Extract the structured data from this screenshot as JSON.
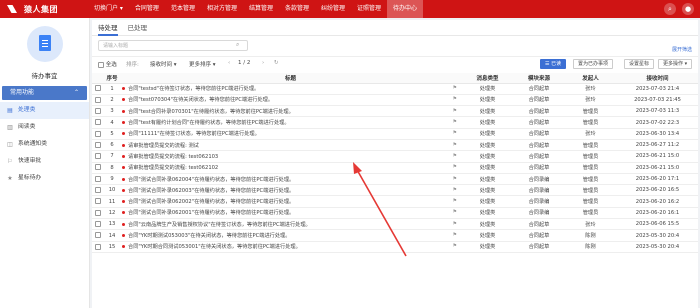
{
  "brand": {
    "name": "猿人集团"
  },
  "nav": [
    {
      "label": "切换门户 ▾"
    },
    {
      "label": "合同管理"
    },
    {
      "label": "范本管理"
    },
    {
      "label": "相对方管理"
    },
    {
      "label": "结算管理"
    },
    {
      "label": "条款管理"
    },
    {
      "label": "纠纷管理"
    },
    {
      "label": "证照管理"
    },
    {
      "label": "待办中心",
      "active": true
    }
  ],
  "sidebar": {
    "title": "待办事宜",
    "section": "常用功能",
    "items": [
      {
        "label": "处理类",
        "icon": "list-icon",
        "active": true
      },
      {
        "label": "阅读类",
        "icon": "book-icon"
      },
      {
        "label": "系统通知类",
        "icon": "bell-icon"
      },
      {
        "label": "快速审批",
        "icon": "check-icon"
      },
      {
        "label": "星标待办",
        "icon": "star-icon"
      }
    ]
  },
  "tabs": [
    {
      "label": "待处理",
      "active": true
    },
    {
      "label": "已处理"
    }
  ],
  "search": {
    "placeholder": "请输入标题"
  },
  "expand_link": "展开筛选",
  "toolbar": {
    "select_all": "全选",
    "sort_label": "排序:",
    "sort_field": "接收时间 ▾",
    "more_sort": "更多排序 ▾",
    "pager": "1 / 2",
    "prev": "‹",
    "next": "›",
    "btn_read": "已读",
    "btn_mark": "置为已办事项",
    "btn_settings": "设置星标",
    "btn_more": "更多操作 ▾"
  },
  "table": {
    "headers": [
      "序号",
      "标题",
      "消息类型",
      "模块来源",
      "发起人",
      "接收时间"
    ],
    "rows": [
      {
        "no": "1",
        "dot": true,
        "title": "合同\"testsd\"在待签订状态，等待您前往PC端进行处理。",
        "type": "处理类",
        "module": "合同起草",
        "sender": "张玲",
        "time": "2023-07-03 21:4"
      },
      {
        "no": "2",
        "dot": true,
        "title": "合同\"test070304\"在待关闭状态，等待您前往PC端进行处理。",
        "type": "处理类",
        "module": "合同起草",
        "sender": "张玲",
        "time": "2023-07-03 21:45"
      },
      {
        "no": "3",
        "dot": true,
        "title": "合同\"test合同补录070301\"在待履约状态，等待您前往PC端进行处理。",
        "type": "处理类",
        "module": "合同起草",
        "sender": "管理员",
        "time": "2023-07-03 11:3"
      },
      {
        "no": "4",
        "dot": true,
        "title": "合同\"test有履约计划合同\"在待履约状态，等待您前往PC端进行处理。",
        "type": "处理类",
        "module": "合同起草",
        "sender": "管理员",
        "time": "2023-07-02 22:3"
      },
      {
        "no": "5",
        "dot": true,
        "title": "合同\"11111\"在待签订状态，等待您前往PC端进行处理。",
        "type": "处理类",
        "module": "合同起草",
        "sender": "张玲",
        "time": "2023-06-30 13:4"
      },
      {
        "no": "6",
        "dot": true,
        "title": "请审批管理员提交的流程: 测试",
        "type": "处理类",
        "module": "合同起草",
        "sender": "管理员",
        "time": "2023-06-27 11:2"
      },
      {
        "no": "7",
        "dot": true,
        "title": "请审批管理员提交的流程: test062103",
        "type": "处理类",
        "module": "合同起草",
        "sender": "管理员",
        "time": "2023-06-21 15:0"
      },
      {
        "no": "8",
        "dot": true,
        "title": "请审批管理员提交的流程: test062102",
        "type": "处理类",
        "module": "合同起草",
        "sender": "管理员",
        "time": "2023-06-21 15:0"
      },
      {
        "no": "9",
        "dot": true,
        "title": "合同\"测试合同补录062004\"在待履约状态，等待您前往PC端进行处理。",
        "type": "处理类",
        "module": "合同录编",
        "sender": "管理员",
        "time": "2023-06-20 17:1"
      },
      {
        "no": "10",
        "dot": true,
        "title": "合同\"测试合同补录062003\"在待履约状态，等待您前往PC端进行处理。",
        "type": "处理类",
        "module": "合同录编",
        "sender": "管理员",
        "time": "2023-06-20 16:5"
      },
      {
        "no": "11",
        "dot": true,
        "title": "合同\"测试合同补录062002\"在待履约状态，等待您前往PC端进行处理。",
        "type": "处理类",
        "module": "合同录编",
        "sender": "管理员",
        "time": "2023-06-20 16:2"
      },
      {
        "no": "12",
        "dot": true,
        "title": "合同\"测试合同补录062001\"在待履约状态，等待您前往PC端进行处理。",
        "type": "处理类",
        "module": "合同录编",
        "sender": "管理员",
        "time": "2023-06-20 16:1"
      },
      {
        "no": "13",
        "dot": true,
        "title": "合同\"云南品牌生产及销售授权协议\"在待签订状态，等待您前往PC端进行处理。",
        "type": "处理类",
        "module": "合同起草",
        "sender": "张玲",
        "time": "2023-06-06 15:5"
      },
      {
        "no": "14",
        "dot": true,
        "title": "合同\"YK时期测试053003\"在待关闭状态，等待您前往PC端进行处理。",
        "type": "处理类",
        "module": "合同起草",
        "sender": "陈刚",
        "time": "2023-05-30 20:4"
      },
      {
        "no": "15",
        "dot": true,
        "title": "合同\"YK时期合同测试053001\"在待关闭状态，等待您前往PC端进行处理。",
        "type": "处理类",
        "module": "合同起草",
        "sender": "陈刚",
        "time": "2023-05-30 20:4"
      }
    ]
  },
  "colors": {
    "brand_red": "#cf1414",
    "accent_blue": "#3b6fd4",
    "annotation_arrow": "#e53935"
  }
}
